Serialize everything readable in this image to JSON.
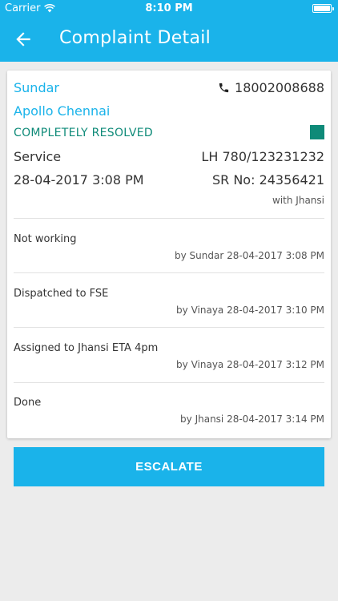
{
  "status_bar": {
    "carrier": "Carrier",
    "time": "8:10 PM"
  },
  "header": {
    "title": "Complaint Detail",
    "back_icon": "arrow-left"
  },
  "complaint": {
    "customer_name": "Sundar",
    "phone": "18002008688",
    "hospital": "Apollo Chennai",
    "status": "COMPLETELY RESOLVED",
    "status_color": "#0e8a78",
    "category": "Service",
    "lh_number": "LH 780/123231232",
    "date_time": "28-04-2017  3:08 PM",
    "sr_number": "SR No: 24356421",
    "assigned_with": "with Jhansi"
  },
  "history": [
    {
      "text": "Not working",
      "meta": "by Sundar 28-04-2017 3:08 PM"
    },
    {
      "text": "Dispatched to FSE",
      "meta": "by Vinaya 28-04-2017 3:10 PM"
    },
    {
      "text": "Assigned to Jhansi ETA 4pm",
      "meta": "by Vinaya 28-04-2017 3:12 PM"
    },
    {
      "text": "Done",
      "meta": "by Jhansi 28-04-2017 3:14 PM"
    }
  ],
  "actions": {
    "escalate_label": "ESCALATE"
  },
  "colors": {
    "primary": "#1ab3ea",
    "background": "#ececec"
  }
}
